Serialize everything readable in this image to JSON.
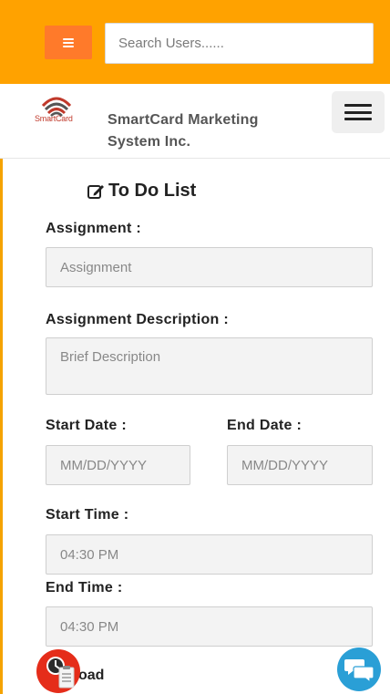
{
  "header": {
    "search_placeholder": "Search Users......"
  },
  "brand": {
    "logo_text": "SmartCard",
    "company_line1": "SmartCard Marketing",
    "company_line2": "System Inc."
  },
  "form": {
    "title": "To Do List",
    "assignment_label": "Assignment :",
    "assignment_placeholder": "Assignment",
    "description_label": "Assignment Description :",
    "description_placeholder": "Brief Description",
    "start_date_label": "Start Date :",
    "start_date_placeholder": "MM/DD/YYYY",
    "end_date_label": "End Date :",
    "end_date_placeholder": "MM/DD/YYYY",
    "start_time_label": "Start Time :",
    "start_time_value": "04:30 PM",
    "end_time_label": "End Time :",
    "end_time_value": "04:30 PM",
    "upload_label_partial": "oad"
  },
  "icons": {
    "menu": "hamburger-icon",
    "nav_toggle": "hamburger-icon",
    "title": "edit-icon",
    "fab_left": "clipboard-clock-icon",
    "fab_right": "chat-bubbles-icon"
  },
  "colors": {
    "topbar": "#ffa200",
    "menu_button": "#ff7a2a",
    "fab_left": "#e52d1a",
    "fab_right": "#2a9fd6"
  }
}
